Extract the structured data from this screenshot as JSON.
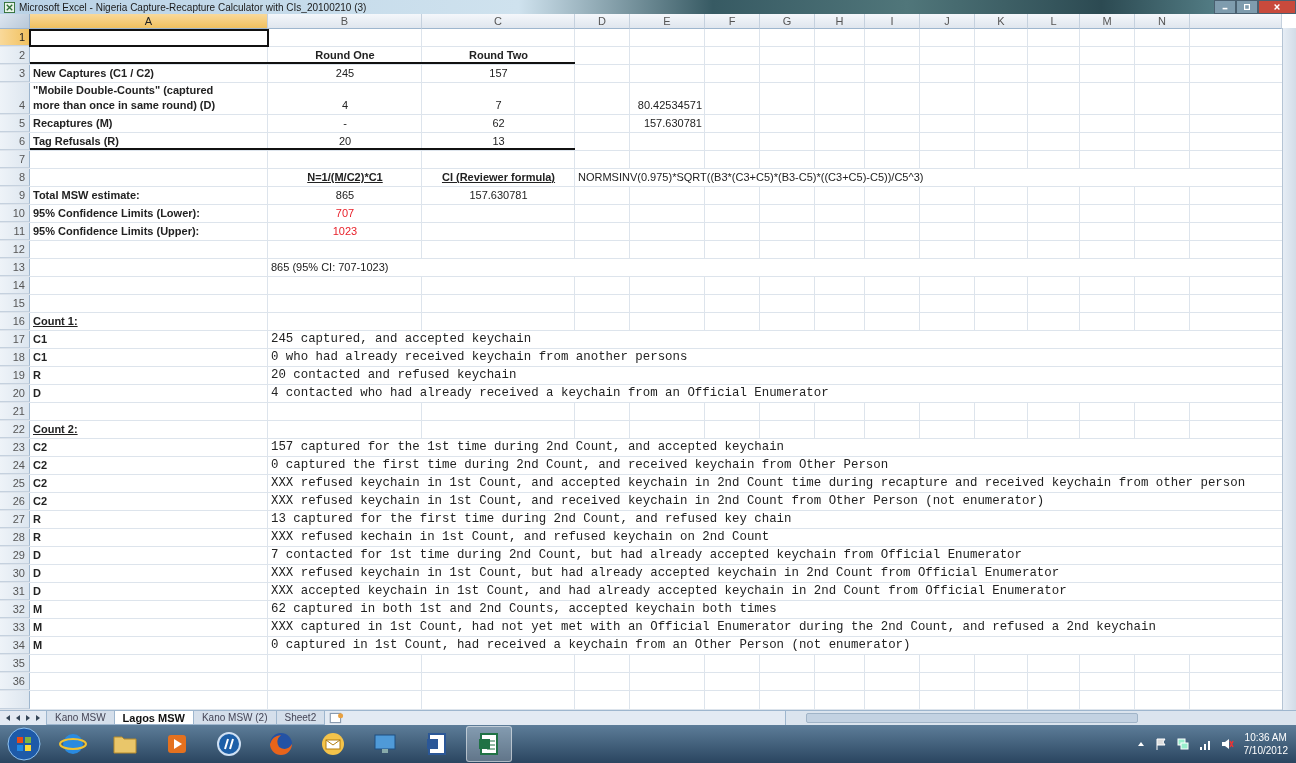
{
  "window": {
    "title": "Microsoft Excel - Nigeria Capture-Recapture Calculator with CIs_20100210 (3)"
  },
  "columns": [
    {
      "label": "A",
      "selected": true
    },
    {
      "label": "B",
      "selected": false
    },
    {
      "label": "C",
      "selected": false
    },
    {
      "label": "D",
      "selected": false
    },
    {
      "label": "E",
      "selected": false
    },
    {
      "label": "F",
      "selected": false
    },
    {
      "label": "G",
      "selected": false
    },
    {
      "label": "H",
      "selected": false
    },
    {
      "label": "I",
      "selected": false
    },
    {
      "label": "J",
      "selected": false
    },
    {
      "label": "K",
      "selected": false
    },
    {
      "label": "L",
      "selected": false
    },
    {
      "label": "M",
      "selected": false
    },
    {
      "label": "N",
      "selected": false
    }
  ],
  "rows": [
    {
      "n": "1",
      "selected": true,
      "rule": false,
      "cells": {}
    },
    {
      "n": "2",
      "selected": false,
      "rule": true,
      "cells": {
        "B": {
          "text": "Round One",
          "kind": "heading"
        },
        "C": {
          "text": "Round Two",
          "kind": "heading"
        }
      }
    },
    {
      "n": "3",
      "selected": false,
      "rule": false,
      "cells": {
        "A": {
          "text": "New Captures (C1 / C2)",
          "kind": "label"
        },
        "B": {
          "text": "245",
          "kind": "value"
        },
        "C": {
          "text": "157",
          "kind": "value"
        }
      }
    },
    {
      "n": "4",
      "selected": false,
      "rule": false,
      "cells": {
        "A": {
          "text": "\"Mobile Double-Counts\" (captured more than once in same round) (D)",
          "kind": "label"
        },
        "B": {
          "text": "4",
          "kind": "value"
        },
        "C": {
          "text": "7",
          "kind": "value"
        },
        "E": {
          "text": "80.42534571",
          "kind": "number"
        }
      }
    },
    {
      "n": "5",
      "selected": false,
      "rule": false,
      "cells": {
        "A": {
          "text": "Recaptures (M)",
          "kind": "label"
        },
        "B": {
          "text": "-",
          "kind": "value"
        },
        "C": {
          "text": "62",
          "kind": "value"
        },
        "E": {
          "text": "157.630781",
          "kind": "number"
        }
      }
    },
    {
      "n": "6",
      "selected": false,
      "rule": true,
      "cells": {
        "A": {
          "text": "Tag Refusals (R)",
          "kind": "label"
        },
        "B": {
          "text": "20",
          "kind": "value"
        },
        "C": {
          "text": "13",
          "kind": "value"
        }
      }
    },
    {
      "n": "7",
      "selected": false,
      "rule": false,
      "cells": {}
    },
    {
      "n": "8",
      "selected": false,
      "rule": false,
      "cells": {
        "B": {
          "text": "N=1/(M/C2)*C1",
          "kind": "formula_heading"
        },
        "C": {
          "text": "CI (Reviewer formula)",
          "kind": "formula_heading"
        },
        "D": {
          "text": "NORMSINV(0.975)*SQRT((B3*(C3+C5)*(B3-C5)*((C3+C5)-C5))/C5^3)",
          "kind": "text"
        }
      }
    },
    {
      "n": "9",
      "selected": false,
      "rule": false,
      "cells": {
        "A": {
          "text": "Total MSW estimate:",
          "kind": "label"
        },
        "B": {
          "text": "865",
          "kind": "value"
        },
        "C": {
          "text": "157.630781",
          "kind": "value"
        }
      }
    },
    {
      "n": "10",
      "selected": false,
      "rule": false,
      "cells": {
        "A": {
          "text": "95% Confidence Limits (Lower):",
          "kind": "label"
        },
        "B": {
          "text": "707",
          "kind": "alert"
        }
      }
    },
    {
      "n": "11",
      "selected": false,
      "rule": false,
      "cells": {
        "A": {
          "text": "95% Confidence Limits (Upper):",
          "kind": "label"
        },
        "B": {
          "text": "1023",
          "kind": "alert"
        }
      }
    },
    {
      "n": "12",
      "selected": false,
      "rule": false,
      "cells": {}
    },
    {
      "n": "13",
      "selected": false,
      "rule": false,
      "cells": {
        "B": {
          "text": "865 (95% CI: 707-1023)",
          "kind": "text"
        }
      }
    },
    {
      "n": "14",
      "selected": false,
      "rule": false,
      "cells": {}
    },
    {
      "n": "15",
      "selected": false,
      "rule": false,
      "cells": {}
    },
    {
      "n": "16",
      "selected": false,
      "rule": false,
      "cells": {
        "A": {
          "text": "Count 1:",
          "kind": "section"
        }
      }
    },
    {
      "n": "17",
      "selected": false,
      "rule": false,
      "cells": {
        "A": {
          "text": "C1",
          "kind": "label"
        },
        "B": {
          "text": "245 captured, and accepted keychain",
          "kind": "code"
        }
      }
    },
    {
      "n": "18",
      "selected": false,
      "rule": false,
      "cells": {
        "A": {
          "text": "C1",
          "kind": "label"
        },
        "B": {
          "text": "0 who had already received keychain from another persons",
          "kind": "code"
        }
      }
    },
    {
      "n": "19",
      "selected": false,
      "rule": false,
      "cells": {
        "A": {
          "text": "R",
          "kind": "label"
        },
        "B": {
          "text": "20 contacted and refused keychain",
          "kind": "code"
        }
      }
    },
    {
      "n": "20",
      "selected": false,
      "rule": false,
      "cells": {
        "A": {
          "text": "D",
          "kind": "label"
        },
        "B": {
          "text": "4 contacted who had already received a keychain from an Official Enumerator",
          "kind": "code"
        }
      }
    },
    {
      "n": "21",
      "selected": false,
      "rule": false,
      "cells": {}
    },
    {
      "n": "22",
      "selected": false,
      "rule": false,
      "cells": {
        "A": {
          "text": "Count 2:",
          "kind": "section"
        }
      }
    },
    {
      "n": "23",
      "selected": false,
      "rule": false,
      "cells": {
        "A": {
          "text": "C2",
          "kind": "label"
        },
        "B": {
          "text": "157 captured for the 1st time during 2nd Count, and accepted keychain",
          "kind": "code"
        }
      }
    },
    {
      "n": "24",
      "selected": false,
      "rule": false,
      "cells": {
        "A": {
          "text": "C2",
          "kind": "label"
        },
        "B": {
          "text": "0 captured the first time during 2nd Count, and received keychain from Other Person",
          "kind": "code"
        }
      }
    },
    {
      "n": "25",
      "selected": false,
      "rule": false,
      "cells": {
        "A": {
          "text": "C2",
          "kind": "label"
        },
        "B": {
          "text": "XXX refused keychain in 1st Count, and accepted keychain in 2nd Count time during recapture and received keychain from other person",
          "kind": "code"
        }
      }
    },
    {
      "n": "26",
      "selected": false,
      "rule": false,
      "cells": {
        "A": {
          "text": "C2",
          "kind": "label"
        },
        "B": {
          "text": "XXX refused keychain in 1st Count,  and received keychain in 2nd Count from Other Person (not enumerator)",
          "kind": "code"
        }
      }
    },
    {
      "n": "27",
      "selected": false,
      "rule": false,
      "cells": {
        "A": {
          "text": "R",
          "kind": "label"
        },
        "B": {
          "text": "13 captured for the first time during 2nd Count, and refused key chain",
          "kind": "code"
        }
      }
    },
    {
      "n": "28",
      "selected": false,
      "rule": false,
      "cells": {
        "A": {
          "text": "R",
          "kind": "label"
        },
        "B": {
          "text": "XXX refused kechain in 1st Count, and refused keychain on 2nd Count",
          "kind": "code"
        }
      }
    },
    {
      "n": "29",
      "selected": false,
      "rule": false,
      "cells": {
        "A": {
          "text": "D",
          "kind": "label"
        },
        "B": {
          "text": "7 contacted for 1st time during 2nd Count, but had already accepted keychain from Official Enumerator",
          "kind": "code"
        }
      }
    },
    {
      "n": "30",
      "selected": false,
      "rule": false,
      "cells": {
        "A": {
          "text": "D",
          "kind": "label"
        },
        "B": {
          "text": "XXX refused keychain in 1st Count, but had already accepted keychain in 2nd Count from Official Enumerator",
          "kind": "code"
        }
      }
    },
    {
      "n": "31",
      "selected": false,
      "rule": false,
      "cells": {
        "A": {
          "text": "D",
          "kind": "label"
        },
        "B": {
          "text": "XXX accepted keychain in 1st Count, and had already accepted keychain in 2nd Count from Official Enumerator",
          "kind": "code"
        }
      }
    },
    {
      "n": "32",
      "selected": false,
      "rule": false,
      "cells": {
        "A": {
          "text": "M",
          "kind": "label"
        },
        "B": {
          "text": "62 captured in both 1st and 2nd Counts, accepted keychain both times",
          "kind": "code"
        }
      }
    },
    {
      "n": "33",
      "selected": false,
      "rule": false,
      "cells": {
        "A": {
          "text": "M",
          "kind": "label"
        },
        "B": {
          "text": "XXX captured in 1st Count, had not yet met with an Official Enumerator during the 2nd Count, and refused a 2nd keychain",
          "kind": "code"
        }
      }
    },
    {
      "n": "34",
      "selected": false,
      "rule": false,
      "cells": {
        "A": {
          "text": "M",
          "kind": "label"
        },
        "B": {
          "text": "0 captured in 1st Count, had received a keychain from an Other Person (not enumerator)",
          "kind": "code"
        }
      }
    },
    {
      "n": "35",
      "selected": false,
      "rule": false,
      "cells": {}
    },
    {
      "n": "36",
      "selected": false,
      "rule": false,
      "cells": {}
    }
  ],
  "sheet_tabs": [
    {
      "label": "Kano MSW",
      "selected": false
    },
    {
      "label": "Lagos MSW",
      "selected": true
    },
    {
      "label": "Kano MSW (2)",
      "selected": false
    },
    {
      "label": "Sheet2",
      "selected": false
    }
  ],
  "taskbar": {
    "apps": [
      {
        "kind": "globe",
        "active": false
      },
      {
        "kind": "folder",
        "active": false
      },
      {
        "kind": "media",
        "active": false
      },
      {
        "kind": "logo",
        "active": false
      },
      {
        "kind": "firefox",
        "active": false
      },
      {
        "kind": "mail",
        "active": false
      },
      {
        "kind": "monitor",
        "active": false
      },
      {
        "kind": "document",
        "active": false
      },
      {
        "kind": "spreadsheet",
        "active": true
      }
    ],
    "time": "10:36 AM",
    "date": "7/10/2012"
  }
}
